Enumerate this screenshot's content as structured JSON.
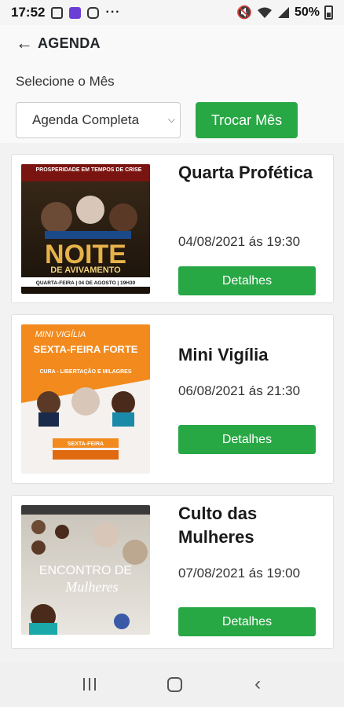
{
  "status_bar": {
    "time": "17:52",
    "dots": "···",
    "battery": "50%"
  },
  "header": {
    "title": "AGENDA",
    "month_label": "Selecione o Mês",
    "select_value": "Agenda Completa",
    "swap_button": "Trocar Mês"
  },
  "events": [
    {
      "title": "Quarta Profética",
      "date": "04/08/2021 ás 19:30",
      "button": "Detalhes",
      "poster": {
        "headline": "PROSPERIDADE EM TEMPOS DE CRISE",
        "main": "NOITE",
        "sub": "DE AVIVAMENTO",
        "footer": "QUARTA-FEIRA | 04 DE AGOSTO | 19H30"
      }
    },
    {
      "title": "Mini Vigília",
      "date": "06/08/2021 ás 21:30",
      "button": "Detalhes",
      "poster": {
        "headline": "MINI VIGÍLIA",
        "main": "SEXTA-FEIRA FORTE",
        "sub": "CURA - LIBERTAÇÃO E MILAGRES",
        "footer": "SEXTA-FEIRA"
      }
    },
    {
      "title": "Culto das Mulheres",
      "date": "07/08/2021 ás 19:00",
      "button": "Detalhes",
      "poster": {
        "headline": "ENCONTRO DE",
        "main": "Mulheres",
        "sub": "",
        "footer": ""
      }
    }
  ]
}
